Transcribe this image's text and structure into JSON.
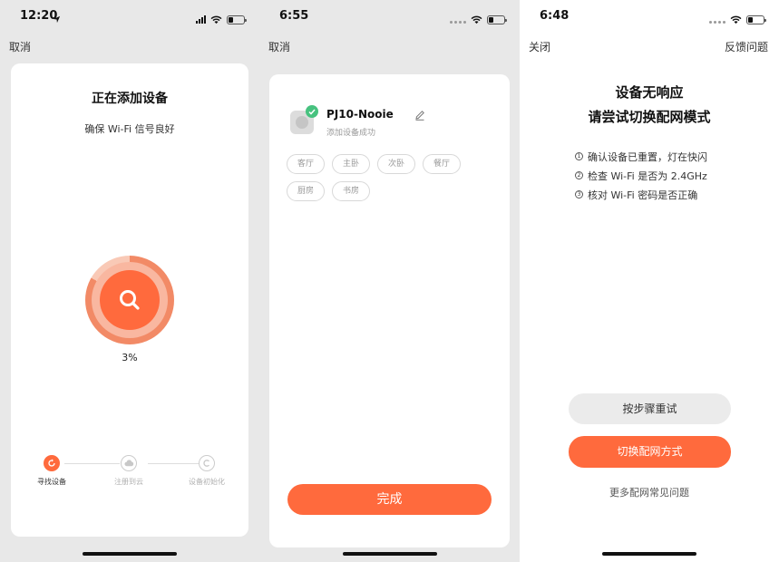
{
  "colors": {
    "accent": "#ff6a3d",
    "success": "#47c27f",
    "background": "#e8e8e8"
  },
  "screen1": {
    "time": "12:20",
    "cancel": "取消",
    "title": "正在添加设备",
    "subtitle": "确保 Wi-Fi 信号良好",
    "progress_text": "3%",
    "progress_value": 0.03,
    "steps": [
      {
        "label": "寻找设备",
        "active": true
      },
      {
        "label": "注册到云",
        "active": false
      },
      {
        "label": "设备初始化",
        "active": false
      }
    ]
  },
  "screen2": {
    "time": "6:55",
    "cancel": "取消",
    "device_name": "PJ10-Nooie",
    "device_status": "添加设备成功",
    "rooms": [
      "客厅",
      "主卧",
      "次卧",
      "餐厅",
      "厨房",
      "书房"
    ],
    "done": "完成"
  },
  "screen3": {
    "time": "6:48",
    "close": "关闭",
    "feedback": "反馈问题",
    "heading1": "设备无响应",
    "heading2": "请尝试切换配网模式",
    "tips": [
      "确认设备已重置，灯在快闪",
      "检查 Wi-Fi 是否为 2.4GHz",
      "核对 Wi-Fi 密码是否正确"
    ],
    "retry": "按步骤重试",
    "switch_mode": "切换配网方式",
    "faq": "更多配网常见问题"
  }
}
